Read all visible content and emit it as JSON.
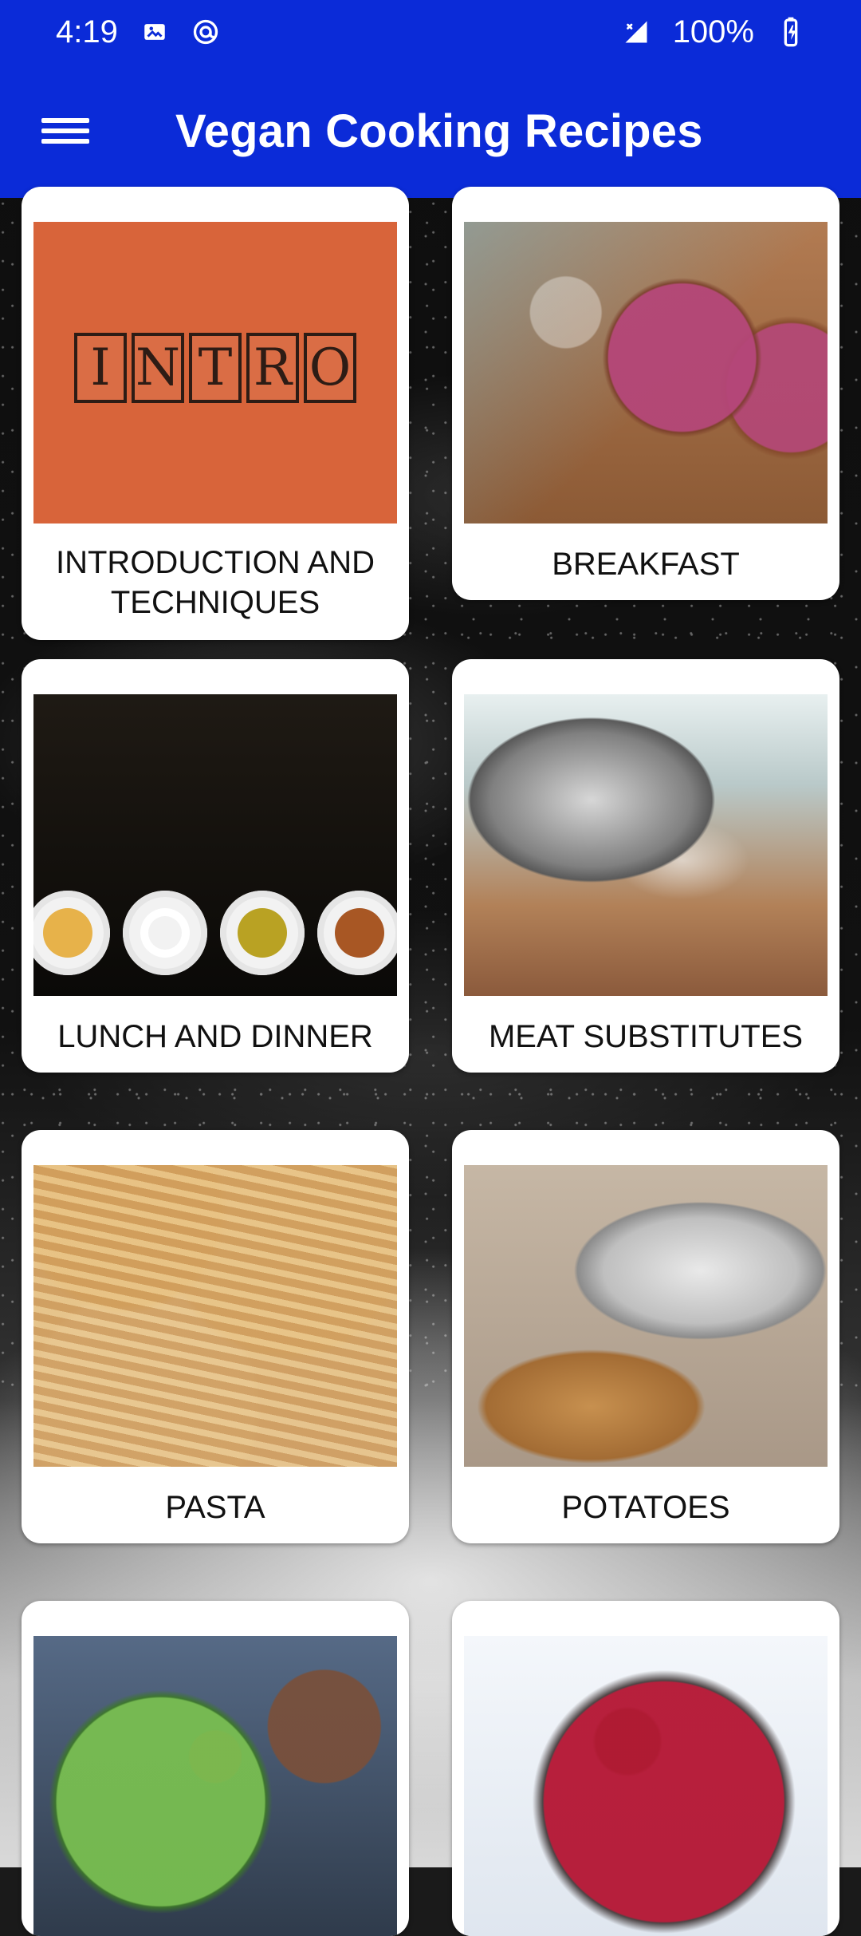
{
  "status_bar": {
    "time": "4:19",
    "battery": "100%",
    "left_icons": [
      "image-icon",
      "at-sign-icon"
    ],
    "right_icons": [
      "signal-icon",
      "battery-charging-icon"
    ]
  },
  "app_bar": {
    "title": "Vegan Cooking Recipes",
    "menu_icon": "hamburger-menu-icon",
    "color": "#0b2bd8"
  },
  "categories": [
    {
      "label": "INTRODUCTION AND\nTECHNIQUES",
      "image": "intro-photo"
    },
    {
      "label": "BREAKFAST",
      "image": "breakfast-bowls-photo"
    },
    {
      "label": "LUNCH AND DINNER",
      "image": "lunch-dinner-plates-photo"
    },
    {
      "label": "MEAT SUBSTITUTES",
      "image": "grill-photo"
    },
    {
      "label": "PASTA",
      "image": "pasta-photo"
    },
    {
      "label": "POTATOES",
      "image": "potatoes-pot-photo"
    },
    {
      "label": "",
      "image": "salad-photo"
    },
    {
      "label": "",
      "image": "beet-dish-photo"
    }
  ]
}
